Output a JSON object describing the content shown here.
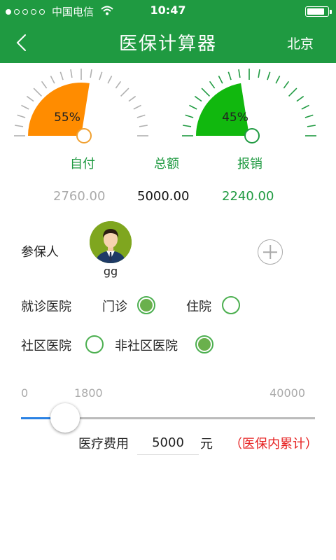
{
  "status_bar": {
    "carrier": "中国电信",
    "time": "10:47",
    "signal_bars_filled": 1,
    "signal_bars_total": 5,
    "battery_level": 0.85
  },
  "nav": {
    "title": "医保计算器",
    "city": "北京"
  },
  "gauges": {
    "self_pay": {
      "percent_label": "55%",
      "fraction": 0.55,
      "color": "#ff8c00"
    },
    "reimburse": {
      "percent_label": "45%",
      "fraction": 0.45,
      "color": "#11b80e"
    }
  },
  "categories": {
    "self_pay": "自付",
    "total": "总额",
    "reimburse": "报销"
  },
  "amounts": {
    "self_pay": "2760.00",
    "total": "5000.00",
    "reimburse": "2240.00"
  },
  "insured": {
    "label": "参保人",
    "name": "gg"
  },
  "hospital": {
    "label": "就诊医院",
    "options": [
      {
        "label": "门诊",
        "checked": true
      },
      {
        "label": "住院",
        "checked": false
      }
    ]
  },
  "community": {
    "options": [
      {
        "label": "社区医院",
        "checked": false
      },
      {
        "label": "非社区医院",
        "checked": true
      }
    ]
  },
  "slider": {
    "min_label": "0",
    "value_label": "1800",
    "max_label": "40000",
    "level": 0.15
  },
  "fee": {
    "label": "医疗费用",
    "value": "5000",
    "unit": "元",
    "note": "（医保内累计）"
  },
  "colors": {
    "brand": "#1f9a41",
    "accent": "#2a82e4",
    "warning": "#e62020"
  }
}
